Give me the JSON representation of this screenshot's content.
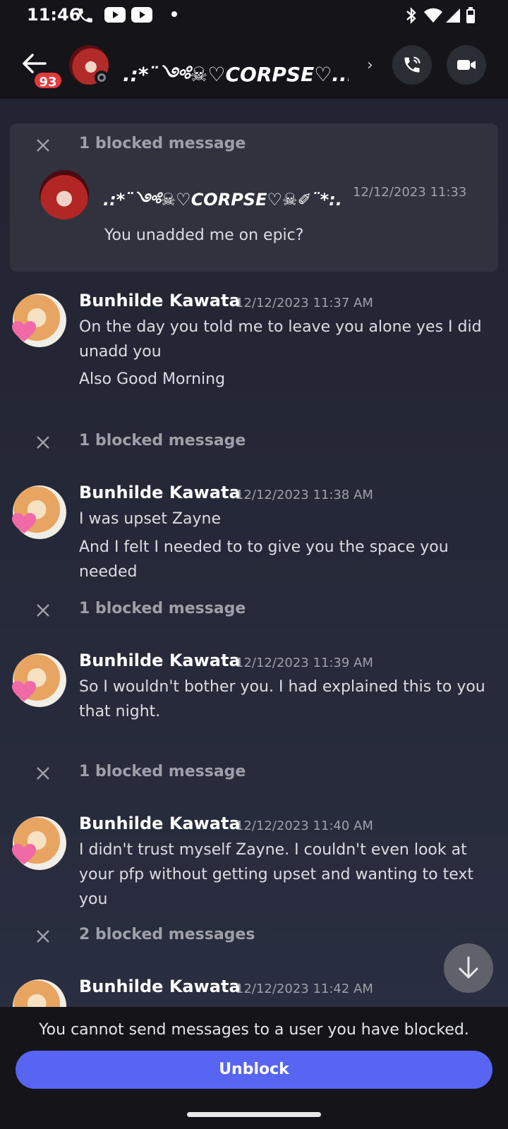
{
  "status_bar": {
    "time": "11:46"
  },
  "header": {
    "badge_count": "93",
    "title": ".:*¨༺☠︎♡CORPSE♡...",
    "chevron": "›"
  },
  "blocked_card": {
    "label": "1 blocked message",
    "author": ".:*¨༺☠︎♡CORPSE♡☠︎✐¨*:.",
    "time": "12/12/2023 11:33",
    "text": "You unadded me on epic?"
  },
  "messages": [
    {
      "author": "Bunhilde Kawata",
      "time": "12/12/2023 11:37 AM",
      "lines": [
        "On the day you told me to leave you alone yes I did unadd you",
        "Also Good Morning"
      ]
    },
    {
      "author": "Bunhilde Kawata",
      "time": "12/12/2023 11:38 AM",
      "lines": [
        "I was upset Zayne",
        "And I felt I needed to to give you the space you needed"
      ]
    },
    {
      "author": "Bunhilde Kawata",
      "time": "12/12/2023 11:39 AM",
      "lines": [
        "So I wouldn't bother you. I had explained this to you that night."
      ]
    },
    {
      "author": "Bunhilde Kawata",
      "time": "12/12/2023 11:40 AM",
      "lines": [
        "I didn't trust myself Zayne. I couldn't even look at your pfp without getting upset and wanting to text you"
      ]
    },
    {
      "author": "Bunhilde Kawata",
      "time": "12/12/2023 11:42 AM",
      "lines": []
    }
  ],
  "blocked_rows": [
    {
      "label": "1 blocked message"
    },
    {
      "label": "1 blocked message"
    },
    {
      "label": "1 blocked message"
    },
    {
      "label": "2 blocked messages"
    }
  ],
  "bottom": {
    "notice": "You cannot send messages to a user you have blocked.",
    "unblock_label": "Unblock"
  },
  "colors": {
    "accent": "#5865f2",
    "badge": "#e43a3d",
    "background": "#262a3a"
  },
  "icons": [
    "phone-icon",
    "youtube-icon",
    "bluetooth-icon",
    "wifi-icon",
    "cellular-icon",
    "battery-icon",
    "back-arrow-icon",
    "phone-call-icon",
    "video-camera-icon",
    "close-icon",
    "arrow-down-icon"
  ]
}
